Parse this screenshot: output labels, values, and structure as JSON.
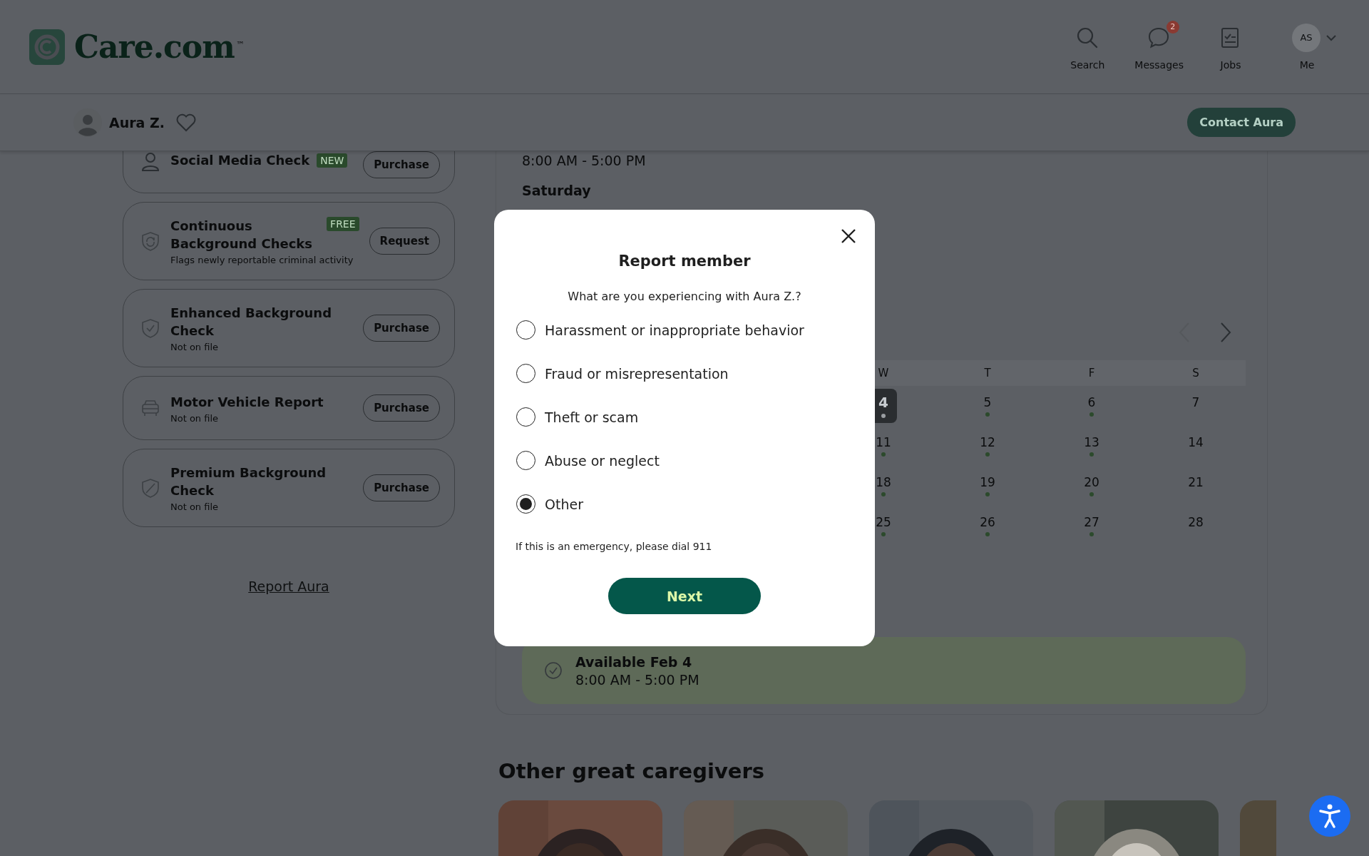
{
  "header": {
    "logo": "Care.com",
    "logo_mark": "™",
    "nav": [
      {
        "label": "Search",
        "kind": "search"
      },
      {
        "label": "Messages",
        "kind": "messages",
        "badge": "2"
      },
      {
        "label": "Jobs",
        "kind": "jobs"
      },
      {
        "label": "Me",
        "kind": "account",
        "initials": "AS"
      }
    ]
  },
  "profile_bar": {
    "name": "Aura Z.",
    "favorite": false,
    "contact_button": "Contact Aura"
  },
  "checks": [
    {
      "title": "Social Media Check",
      "kind": "social",
      "tag": "NEW",
      "action": "Purchase"
    },
    {
      "title": "Continuous Background Checks",
      "kind": "continuous",
      "tag": "FREE",
      "subtitle": "Flags newly reportable criminal activity",
      "action": "Request"
    },
    {
      "title": "Enhanced Background Check",
      "kind": "enhanced",
      "subtitle": "Not on file",
      "action": "Purchase"
    },
    {
      "title": "Motor Vehicle Report",
      "kind": "vehicle",
      "subtitle": "Not on file",
      "action": "Purchase"
    },
    {
      "title": "Premium Background Check",
      "kind": "premium",
      "subtitle": "Not on file",
      "action": "Purchase"
    }
  ],
  "report_link": "Report Aura",
  "schedule": {
    "time": "8:00 AM - 5:00 PM",
    "day": "Saturday"
  },
  "calendar": {
    "prev_disabled": true,
    "weekdays": [
      "W",
      "T",
      "F",
      "S"
    ],
    "weeks": [
      [
        {
          "day": "4",
          "selected": true,
          "available": true
        },
        {
          "day": "5",
          "selected": false,
          "available": true
        },
        {
          "day": "6",
          "selected": false,
          "available": true
        },
        {
          "day": "7",
          "selected": false,
          "available": false
        }
      ],
      [
        {
          "day": "11",
          "selected": false,
          "available": true
        },
        {
          "day": "12",
          "selected": false,
          "available": true
        },
        {
          "day": "13",
          "selected": false,
          "available": true
        },
        {
          "day": "14",
          "selected": false,
          "available": false
        }
      ],
      [
        {
          "day": "18",
          "selected": false,
          "available": true
        },
        {
          "day": "19",
          "selected": false,
          "available": true
        },
        {
          "day": "20",
          "selected": false,
          "available": true
        },
        {
          "day": "21",
          "selected": false,
          "available": false
        }
      ],
      [
        {
          "day": "25",
          "selected": false,
          "available": true
        },
        {
          "day": "26",
          "selected": false,
          "available": true
        },
        {
          "day": "27",
          "selected": false,
          "available": true
        },
        {
          "day": "28",
          "selected": false,
          "available": false
        }
      ]
    ]
  },
  "availability": {
    "title": "Available Feb 4",
    "time": "8:00 AM - 5:00 PM"
  },
  "caregivers": {
    "heading": "Other great caregivers"
  },
  "modal": {
    "title": "Report member",
    "question": "What are you experiencing with Aura Z.?",
    "options": [
      {
        "label": "Harassment or inappropriate behavior",
        "selected": false
      },
      {
        "label": "Fraud or misrepresentation",
        "selected": false
      },
      {
        "label": "Theft or scam",
        "selected": false
      },
      {
        "label": "Abuse or neglect",
        "selected": false
      },
      {
        "label": "Other",
        "selected": true
      }
    ],
    "note": "If this is an emergency, please dial 911",
    "button": "Next"
  }
}
